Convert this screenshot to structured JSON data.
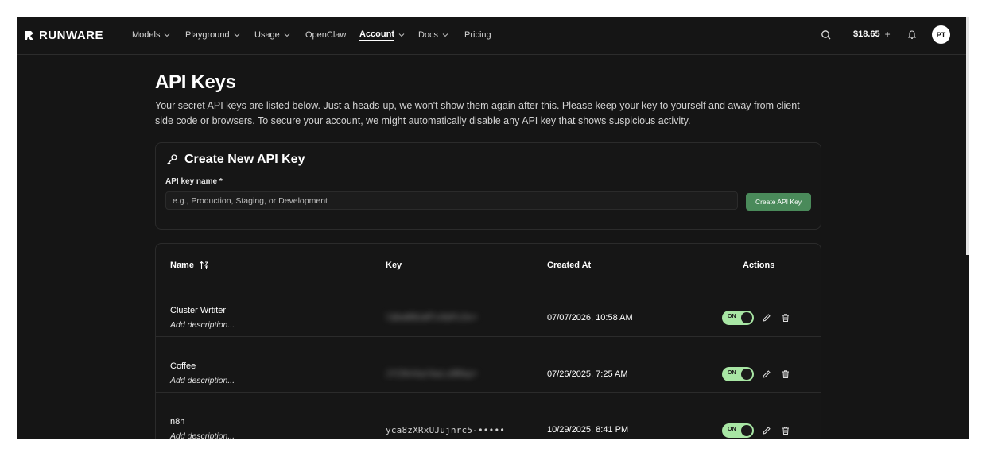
{
  "brand": {
    "name": "RUNWARE"
  },
  "nav": {
    "items": [
      {
        "label": "Models",
        "dropdown": true
      },
      {
        "label": "Playground",
        "dropdown": true
      },
      {
        "label": "Usage",
        "dropdown": true
      },
      {
        "label": "OpenClaw",
        "dropdown": false
      },
      {
        "label": "Account",
        "dropdown": true,
        "active": true
      },
      {
        "label": "Docs",
        "dropdown": true
      },
      {
        "label": "Pricing",
        "dropdown": false
      }
    ],
    "balance": "$18.65",
    "balance_plus": "+",
    "avatar_initials": "PT",
    "icons": [
      "search-icon",
      "bell-icon"
    ]
  },
  "page": {
    "title": "API Keys",
    "description": "Your secret API keys are listed below. Just a heads-up, we won't show them again after this. Please keep your key to yourself and away from client-side code or browsers. To secure your account, we might automatically disable any API key that shows suspicious activity."
  },
  "create": {
    "title": "Create New API Key",
    "icon": "key-icon",
    "field_label": "API key name *",
    "placeholder": "e.g., Production, Staging, or Development",
    "value": "",
    "button_label": "Create API Key",
    "button_color": "#4a8a5a"
  },
  "table": {
    "columns": {
      "name": "Name",
      "key": "Key",
      "created": "Created At",
      "actions": "Actions"
    },
    "rows": [
      {
        "name": "Cluster Wrtiter",
        "description": "Add description...",
        "key": "lQkmR8sWTvXbPz3n•",
        "key_blurred": true,
        "created_at": "07/07/2026, 10:58 AM",
        "toggle_label": "ON",
        "enabled": true
      },
      {
        "name": "Coffee",
        "description": "Add description...",
        "key": "Jf29nVqtXwLs8Rkp•",
        "key_blurred": true,
        "created_at": "07/26/2025, 7:25 AM",
        "toggle_label": "ON",
        "enabled": true
      },
      {
        "name": "n8n",
        "description": "Add description...",
        "key": "yca8zXRxUJujnrc5-•••••",
        "key_blurred": false,
        "created_at": "10/29/2025, 8:41 PM",
        "toggle_label": "ON",
        "enabled": true
      }
    ],
    "toggle_color": "#a8e6a4"
  }
}
